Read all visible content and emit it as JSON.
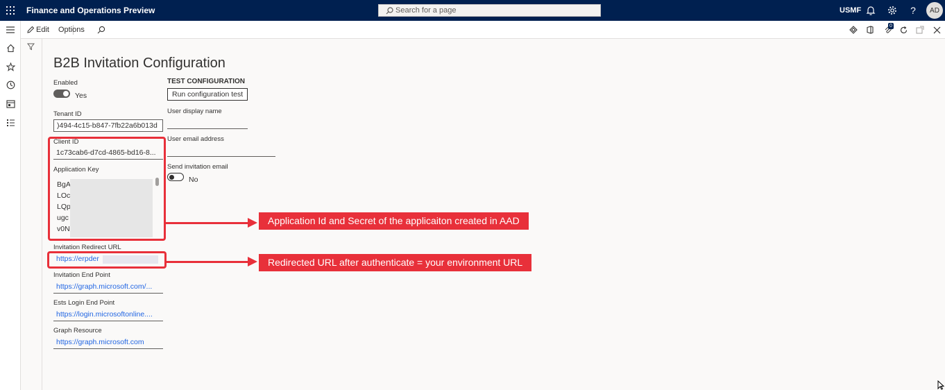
{
  "topbar": {
    "app_title": "Finance and Operations Preview",
    "search_placeholder": "Search for a page",
    "company": "USMF",
    "avatar": "AD"
  },
  "actionbar": {
    "edit_label": "Edit",
    "options_label": "Options",
    "notification_count": "0"
  },
  "form": {
    "title": "B2B Invitation Configuration",
    "enabled_label": "Enabled",
    "enabled_value": "Yes",
    "tenant_id_label": "Tenant ID",
    "tenant_id_value": ")494-4c15-b847-7fb22a6b013d",
    "client_id_label": "Client ID",
    "client_id_value": "1c73cab6-d7cd-4865-bd16-8...",
    "app_key_label": "Application Key",
    "app_key_lines": [
      "BgA",
      "LOc",
      "LQp",
      "ugc",
      "v0N"
    ],
    "redirect_label": "Invitation Redirect URL",
    "redirect_value": "https://erpder",
    "endpoint_label": "Invitation End Point",
    "endpoint_value": "https://graph.microsoft.com/...",
    "ests_label": "Ests Login End Point",
    "ests_value": "https://login.microsoftonline....",
    "graph_label": "Graph Resource",
    "graph_value": "https://graph.microsoft.com"
  },
  "test_config": {
    "heading": "TEST CONFIGURATION",
    "run_button": "Run configuration test",
    "display_name_label": "User display name",
    "email_label": "User email address",
    "send_label": "Send invitation email",
    "send_value": "No"
  },
  "annotations": {
    "callout_1": "Application Id and Secret of the applicaiton created in AAD",
    "callout_2": "Redirected URL after authenticate = your environment URL",
    "color": "#e8303a"
  },
  "colors": {
    "topbar": "#002050",
    "link": "#2266e3"
  }
}
